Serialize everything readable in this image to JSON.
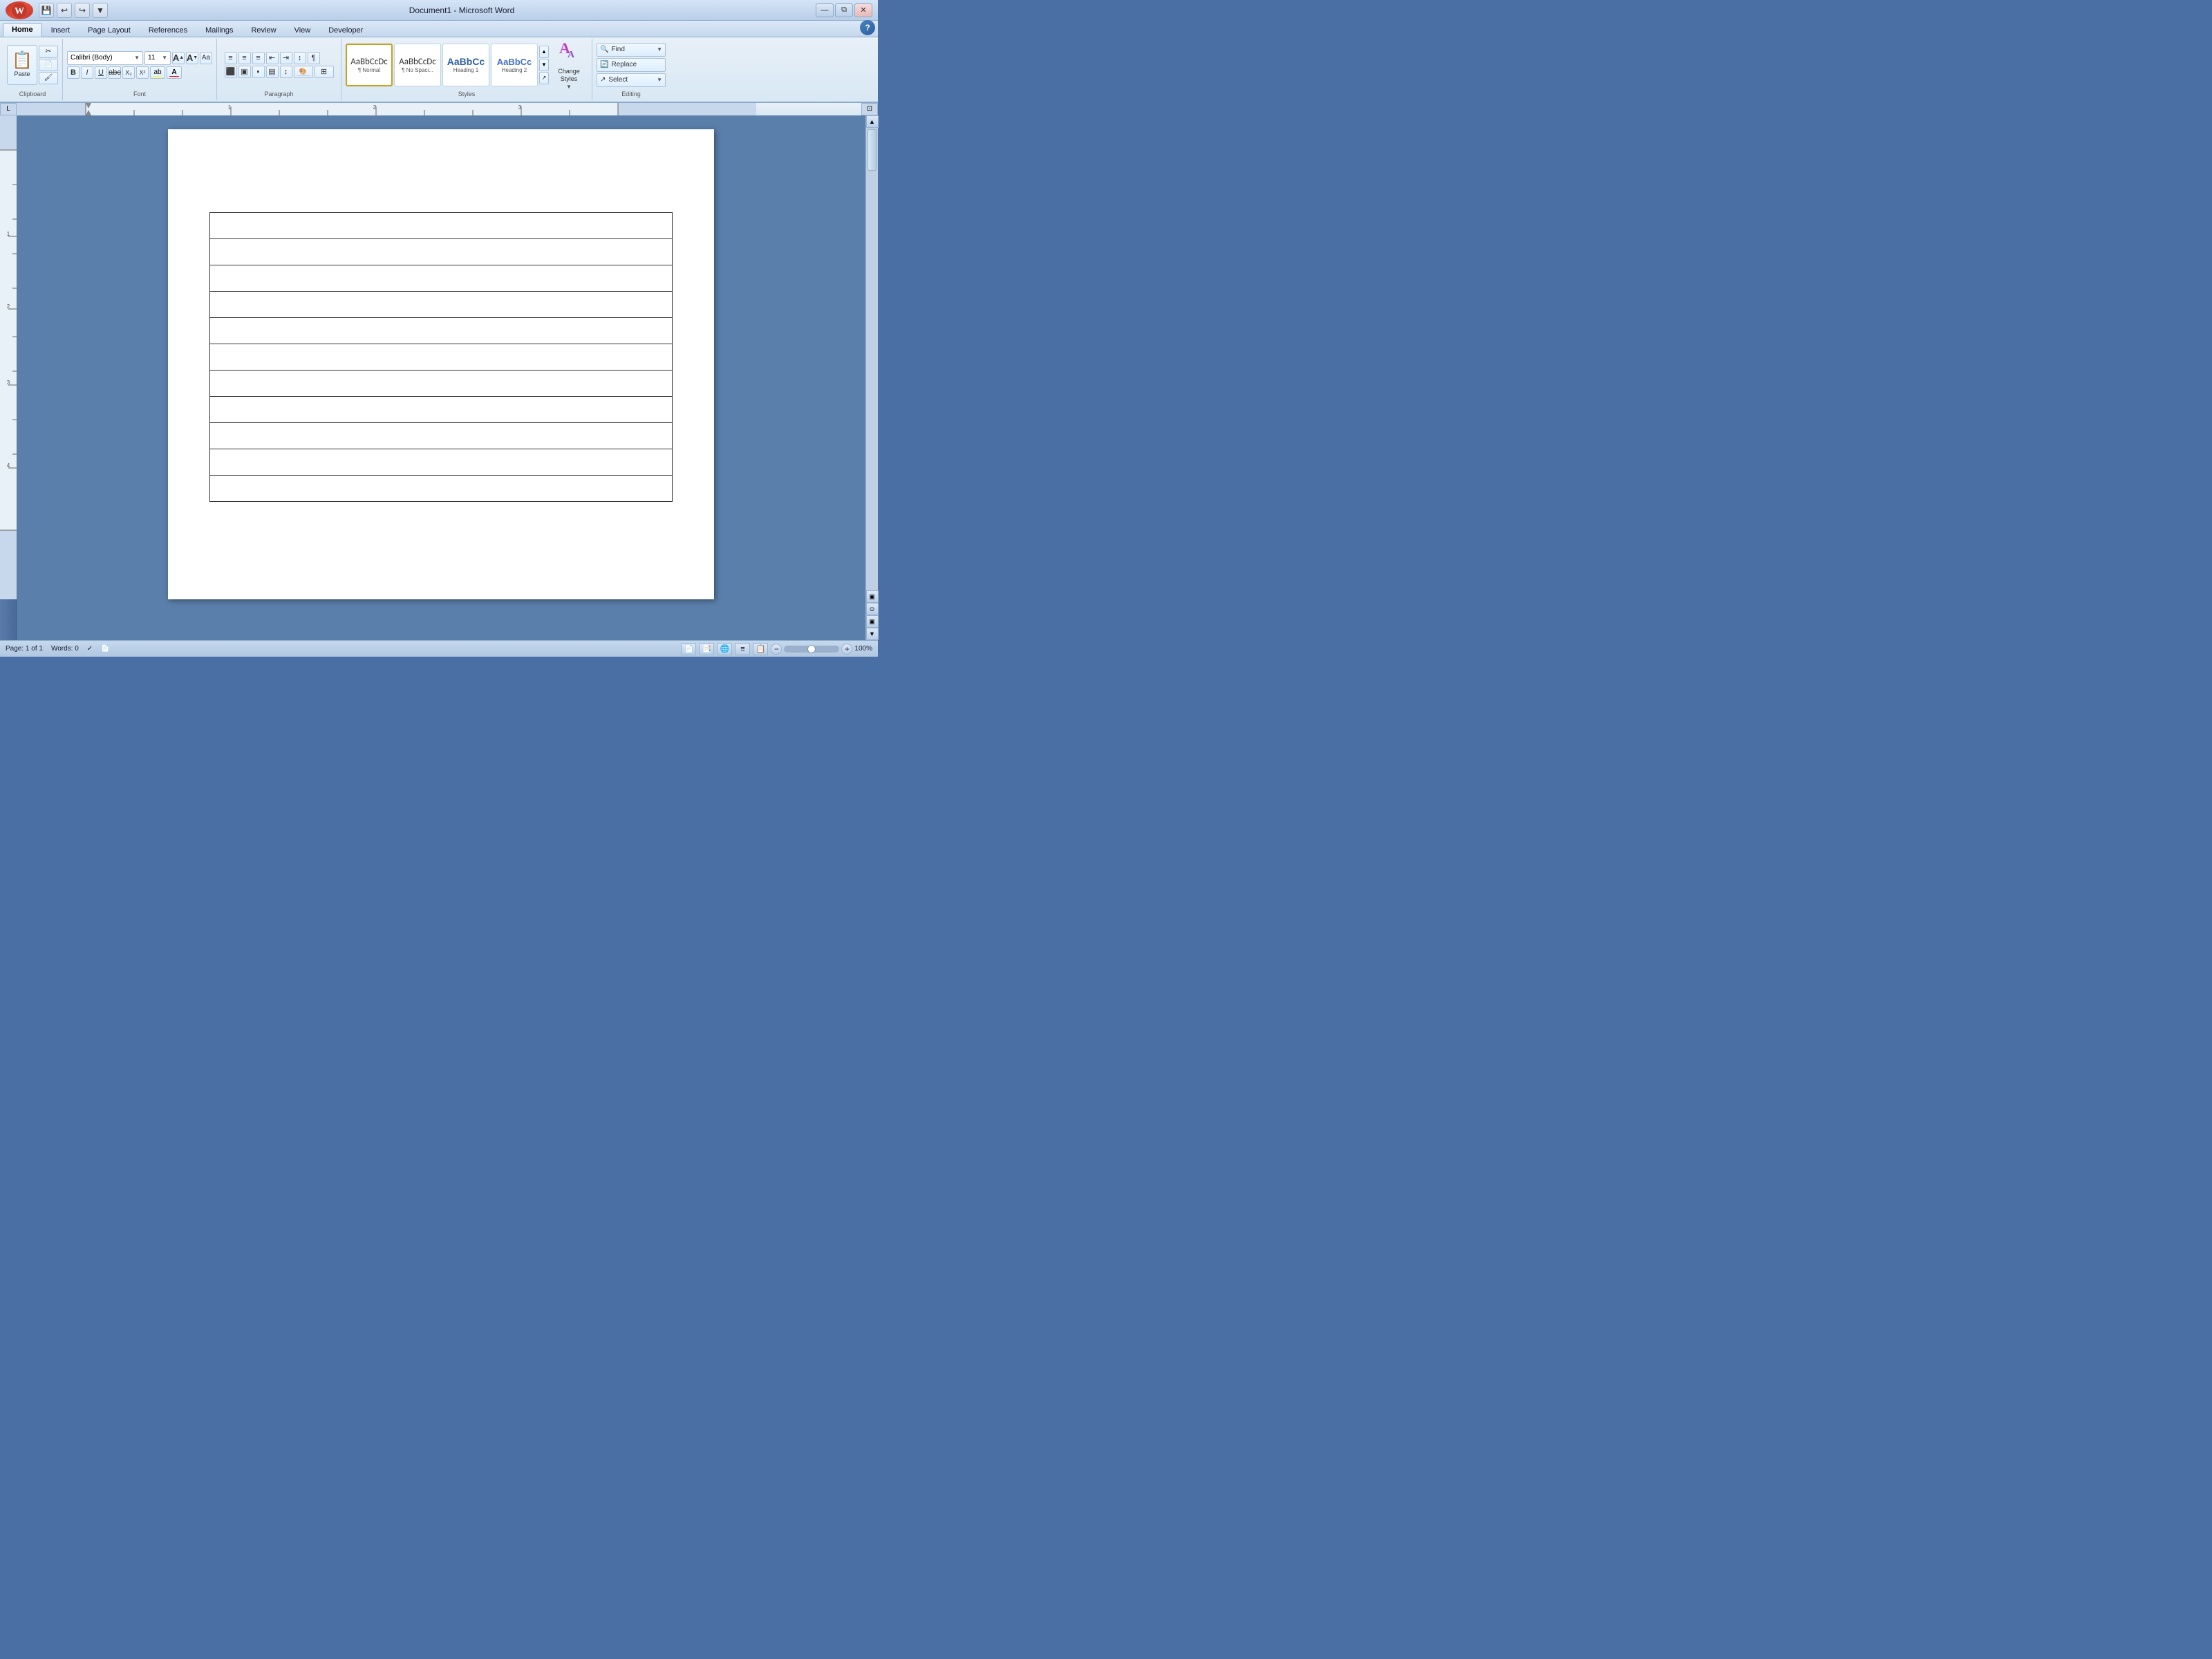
{
  "titleBar": {
    "title": "Document1 - Microsoft Word",
    "qatButtons": [
      "💾",
      "↩",
      "↪",
      "▼"
    ],
    "windowControls": [
      "—",
      "⧉",
      "✕"
    ]
  },
  "ribbonTabs": {
    "tabs": [
      "Home",
      "Insert",
      "Page Layout",
      "References",
      "Mailings",
      "Review",
      "View",
      "Developer"
    ],
    "activeTab": "Home"
  },
  "clipboard": {
    "groupLabel": "Clipboard",
    "pasteLabel": "Paste",
    "buttons": [
      "✂",
      "📋",
      "🖌"
    ]
  },
  "font": {
    "groupLabel": "Font",
    "fontName": "Calibri (Body)",
    "fontSize": "11",
    "growLabel": "A",
    "shrinkLabel": "A",
    "clearLabel": "Aa",
    "boldLabel": "B",
    "italicLabel": "I",
    "underlineLabel": "U",
    "strikeLabel": "abc",
    "subLabel": "X₂",
    "superLabel": "X²",
    "fontColorLabel": "A",
    "highlightLabel": "ab"
  },
  "paragraph": {
    "groupLabel": "Paragraph",
    "buttons": [
      "≡",
      "≡",
      "≡",
      "≡",
      "≡",
      "≡",
      "≡",
      "≡",
      "▤",
      "⌑",
      "↕",
      "¶"
    ]
  },
  "styles": {
    "groupLabel": "Styles",
    "styleCards": [
      {
        "preview": "AaBbCcDc",
        "label": "¶ Normal",
        "type": "normal"
      },
      {
        "preview": "AaBbCcDc",
        "label": "¶ No Spaci...",
        "type": "nospace"
      },
      {
        "preview": "AaBbCc",
        "label": "Heading 1",
        "type": "h1"
      },
      {
        "preview": "AaBbCc",
        "label": "Heading 2",
        "type": "h2"
      }
    ],
    "changeStylesLabel": "Change\nStyles",
    "expandLabel": "↗"
  },
  "editing": {
    "groupLabel": "Editing",
    "findLabel": "Find",
    "replaceLabel": "Replace",
    "selectLabel": "Select"
  },
  "document": {
    "tableRows": 11,
    "tableCols": 1
  },
  "statusBar": {
    "pageInfo": "Page: 1 of 1",
    "wordCount": "Words: 0",
    "zoomLevel": "100%",
    "viewButtons": [
      "📄",
      "📑",
      "📋",
      "📊",
      "🔍"
    ]
  }
}
